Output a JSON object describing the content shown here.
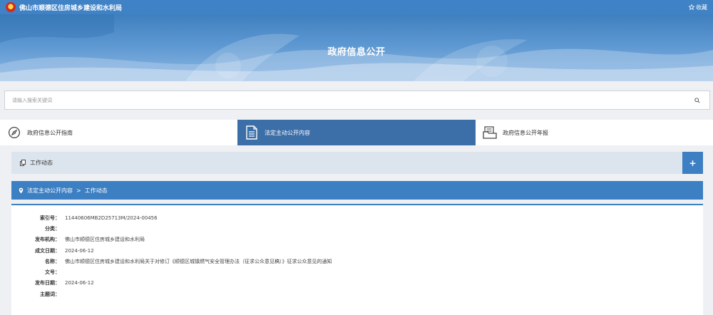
{
  "topbar": {
    "site_name": "佛山市顺德区住房城乡建设和水利局",
    "favorite": "收藏"
  },
  "banner": {
    "title": "政府信息公开"
  },
  "search": {
    "placeholder": "请输入搜索关键词"
  },
  "tabs": [
    {
      "label": "政府信息公开指南",
      "icon": "compass-icon",
      "active": false
    },
    {
      "label": "法定主动公开内容",
      "icon": "document-list-icon",
      "active": true
    },
    {
      "label": "政府信息公开年报",
      "icon": "report-folder-icon",
      "active": false
    }
  ],
  "column": {
    "title": "工作动态",
    "expand": "+"
  },
  "breadcrumb": {
    "level1": "法定主动公开内容",
    "separator": ">",
    "level2": "工作动态"
  },
  "meta": {
    "index_label": "索引号：",
    "index_value": "11440606MB2D25713M/2024-00456",
    "category_label": "分类：",
    "category_value": "",
    "publisher_label": "发布机构：",
    "publisher_value": "佛山市顺德区住房城乡建设和水利局",
    "created_label": "成文日期：",
    "created_value": "2024-06-12",
    "name_label": "名称：",
    "name_value": "佛山市顺德区住房城乡建设和水利局关于对修订《顺德区城镇燃气安全管理办法（征求公众意见稿）》征求公众意见的通知",
    "docno_label": "文号：",
    "docno_value": "",
    "published_label": "发布日期：",
    "published_value": "2024-06-12",
    "subject_label": "主题词：",
    "subject_value": ""
  },
  "colors": {
    "topbar": "#3f82c6",
    "tab_active": "#3c6ea8",
    "accent": "#3c7fc2",
    "column_bg": "#dce5ee"
  }
}
